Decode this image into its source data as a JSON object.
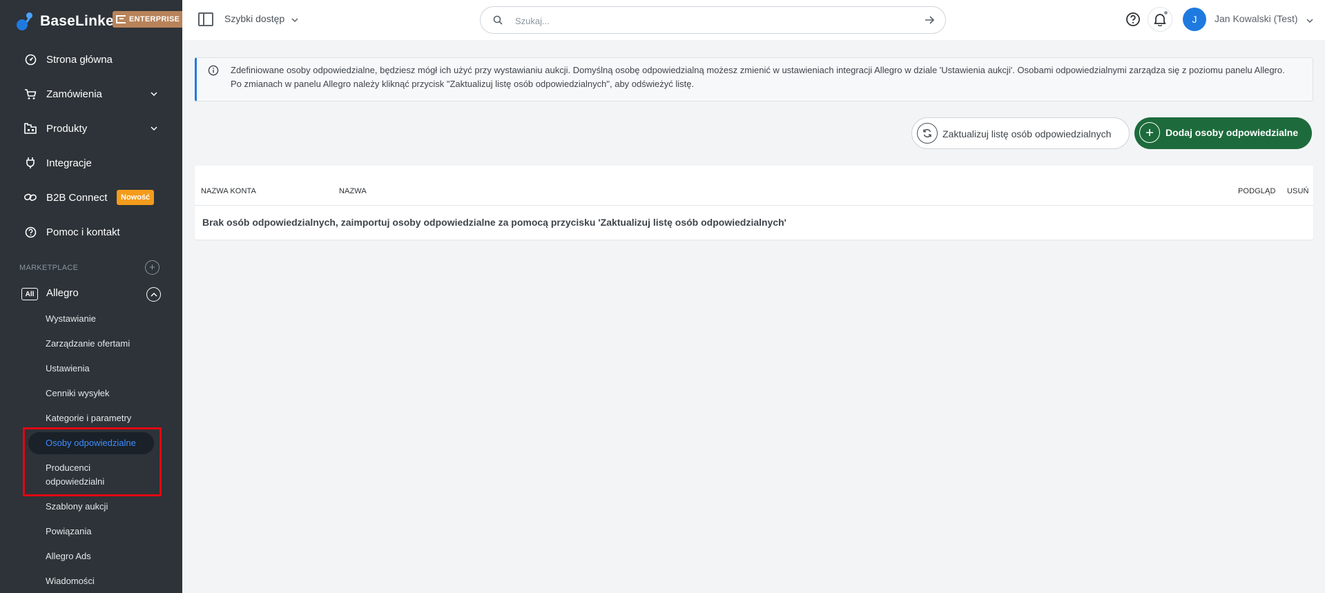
{
  "brand": {
    "name": "BaseLinker",
    "plan_badge": "ENTERPRISE"
  },
  "sidebar": {
    "nav": [
      {
        "label": "Strona główna",
        "icon": "dashboard-icon"
      },
      {
        "label": "Zamówienia",
        "icon": "cart-icon"
      },
      {
        "label": "Produkty",
        "icon": "products-icon"
      },
      {
        "label": "Integracje",
        "icon": "plug-icon"
      },
      {
        "label": "B2B Connect",
        "icon": "link-icon",
        "badge": "Nowość"
      },
      {
        "label": "Pomoc i kontakt",
        "icon": "help-icon"
      }
    ],
    "section_label": "MARKETPLACE",
    "marketplace": {
      "tag": "All",
      "label": "Allegro"
    },
    "submenu": [
      "Wystawianie",
      "Zarządzanie ofertami",
      "Ustawienia",
      "Cenniki wysyłek",
      "Kategorie i parametry",
      "Osoby odpowiedzialne",
      "Producenci odpowiedzialni",
      "Szablony aukcji",
      "Powiązania",
      "Allegro Ads",
      "Wiadomości"
    ],
    "active_submenu": "Osoby odpowiedzialne"
  },
  "topbar": {
    "quick_access": "Szybki dostęp",
    "search_placeholder": "Szukaj...",
    "avatar_initial": "J",
    "user_name": "Jan Kowalski (Test)"
  },
  "info": {
    "text": "Zdefiniowane osoby odpowiedzialne, będziesz mógł ich użyć przy wystawianiu aukcji. Domyślną osobę odpowiedzialną możesz zmienić w ustawieniach integracji Allegro w dziale 'Ustawienia aukcji'. Osobami odpowiedzialnymi zarządza się z poziomu panelu Allegro. Po zmianach w panelu Allegro należy kliknąć przycisk \"Zaktualizuj listę osób odpowiedzialnych\", aby odświeżyć listę."
  },
  "actions": {
    "update_label": "Zaktualizuj listę osób odpowiedzialnych",
    "add_label": "Dodaj osoby odpowiedzialne"
  },
  "table": {
    "columns": [
      "NAZWA KONTA",
      "NAZWA",
      "PODGLĄD",
      "USUŃ"
    ],
    "empty_message": "Brak osób odpowiedzialnych, zaimportuj osoby odpowiedzialne za pomocą przycisku 'Zaktualizuj listę osób odpowiedzialnych'"
  },
  "colors": {
    "sidebar_bg": "#2d3338",
    "accent_blue": "#1f7ae0",
    "add_button": "#1d6b3c",
    "badge_orange": "#f39b1c",
    "highlight_red": "#e30613"
  }
}
